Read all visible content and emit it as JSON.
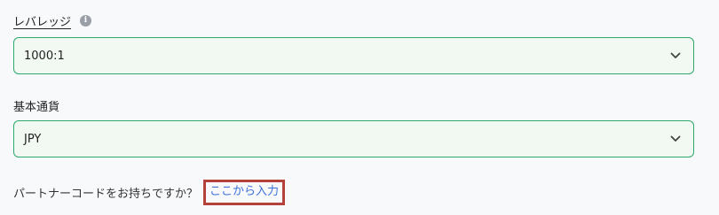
{
  "leverage": {
    "label": "レバレッジ",
    "info_glyph": "i",
    "value": "1000:1"
  },
  "base_currency": {
    "label": "基本通貨",
    "value": "JPY"
  },
  "partner": {
    "question": "パートナーコードをお持ちですか？",
    "link_label": "ここから入力"
  },
  "colors": {
    "border_accent": "#2ea86c",
    "field_background": "#f2f8f2",
    "link": "#3a6fd8",
    "highlight_box": "#b5413d"
  }
}
